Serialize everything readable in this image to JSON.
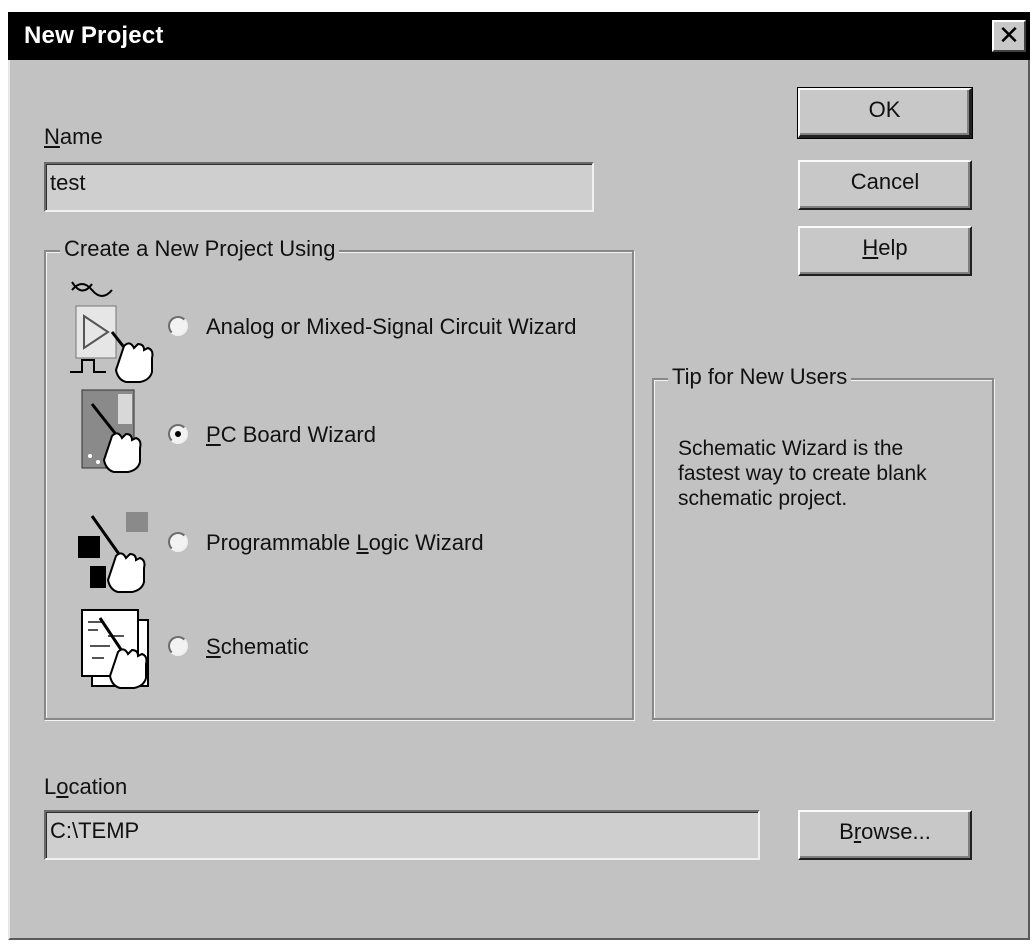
{
  "window": {
    "title": "New Project",
    "close_glyph": "✕"
  },
  "name": {
    "label_prefix": "",
    "label_key": "N",
    "label_rest": "ame",
    "value": "test"
  },
  "buttons": {
    "ok": "OK",
    "cancel": "Cancel",
    "help_key": "H",
    "help_rest": "elp",
    "browse_pre": "B",
    "browse_key": "r",
    "browse_rest": "owse..."
  },
  "group": {
    "legend": "Create a New Project Using",
    "options": [
      {
        "pre": "Analog or Mixed-Signal Circuit Wizard",
        "key": "",
        "rest": "",
        "checked": false,
        "icon": "analog-wizard-icon"
      },
      {
        "pre": "",
        "key": "P",
        "rest": "C Board Wizard",
        "checked": true,
        "icon": "pcb-wizard-icon"
      },
      {
        "pre": "Programmable ",
        "key": "L",
        "rest": "ogic Wizard",
        "checked": false,
        "icon": "logic-wizard-icon"
      },
      {
        "pre": "",
        "key": "S",
        "rest": "chematic",
        "checked": false,
        "icon": "schematic-icon"
      }
    ]
  },
  "tip": {
    "legend": "Tip for New Users",
    "lines": [
      "Schematic Wizard is the",
      "fastest way to create blank",
      "schematic project."
    ]
  },
  "location": {
    "label_pre": "L",
    "label_key": "o",
    "label_rest": "cation",
    "value": "C:\\TEMP"
  }
}
